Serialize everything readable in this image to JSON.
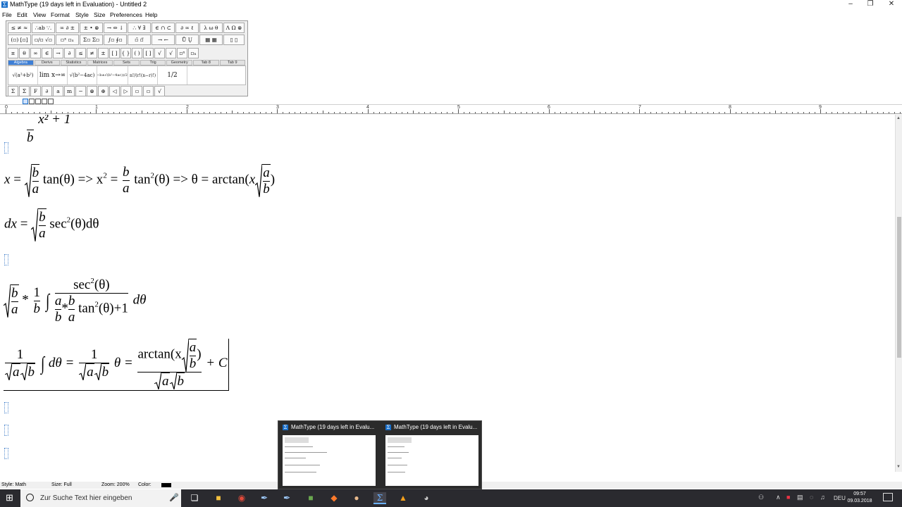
{
  "window": {
    "title": "MathType (19 days left in Evaluation) - Untitled 2",
    "app_icon": "Σ"
  },
  "menu": [
    "File",
    "Edit",
    "View",
    "Format",
    "Style",
    "Size",
    "Preferences",
    "Help"
  ],
  "toolbar": {
    "row1": [
      "≤ ≠ ≈",
      "∴ab ∵.",
      "∞ ∂ ±",
      "± • ⊗",
      "→ ⇔ ↓",
      "∴ ∀ ∃",
      "∈ ∩ ⊂",
      "∂ ∞ ℓ",
      "λ ω θ",
      "Λ Ω ⊗"
    ],
    "row2": [
      "(▫) [▫]",
      "▫/▫ √▫",
      "▫ˣ ▫ₓ",
      "Σ▫ Σ▫",
      "∫▫ ∮▫",
      "▫̄ ▫⃗",
      "→ ←",
      "Ů Ų",
      "▦ ▦",
      "▯ ▯"
    ],
    "row3": [
      "π",
      "θ",
      "∞",
      "∈",
      "→",
      "∂",
      "≤",
      "≠",
      "±",
      "[ ]",
      "{ }",
      "( )",
      "[ ]",
      "√",
      "√",
      "▫ⁿ",
      "▫ₙ"
    ],
    "tabs": [
      "Algebra",
      "Derivs",
      "Statistics",
      "Matrices",
      "Sets",
      "Trig",
      "Geometry",
      "Tab 8",
      "Tab 9"
    ],
    "active_tab": "Algebra",
    "bigrow": [
      "√(a²+b²)",
      "lim x→∞",
      "√(b²−4ac)",
      "(−b±√(b²−4ac))/2a",
      "n!/(r!(n−r)!)",
      "1/2"
    ],
    "row4": [
      "Σ",
      "Σ̄",
      "F",
      "∂",
      "a",
      "m",
      "−",
      "⊗",
      "⊕",
      "◁",
      "▷",
      "▫",
      "▫",
      "√"
    ]
  },
  "ruler": {
    "labels": [
      "0",
      "1",
      "2",
      "3",
      "4",
      "5",
      "6",
      "7",
      "8",
      "9"
    ]
  },
  "equations": {
    "partial_top": {
      "num": "",
      "den": "b",
      "rest": "x² + 1"
    },
    "eq1": {
      "x": "x",
      "eq": "=",
      "tan": "tan(θ) => x",
      "sq": "2",
      "eq2": "=",
      "b": "b",
      "a": "a",
      "tan2": "tan",
      "theta_impl": "(θ) => θ = arctan(",
      "xin": "x",
      "close": ")"
    },
    "eq2": {
      "dx": "dx",
      "eq": "=",
      "sec": "sec",
      "sq": "2",
      "rest": "(θ)dθ"
    },
    "eq3": {
      "times": "*",
      "one": "1",
      "secnum": "sec",
      "thetanum": "(θ)",
      "tan": "tan",
      "tanrest": "(θ)+1",
      "dtheta": "dθ"
    },
    "eq4": {
      "one": "1",
      "dtheta": "dθ =",
      "theta": "θ =",
      "arctan": "arctan(x",
      "close": ")",
      "plusc": "+ C"
    }
  },
  "status": {
    "style": "Style: Math",
    "size": "Size: Full",
    "zoom": "Zoom: 200%",
    "color": "Color:",
    "color_value": "#000000"
  },
  "taskbar": {
    "search_placeholder": "Zur Suche Text hier eingeben",
    "lang": "DEU",
    "time": "09:57",
    "date": "09.03.2018"
  },
  "preview": [
    {
      "title": "MathType (19 days left in Evalu..."
    },
    {
      "title": "MathType (19 days left in Evalu..."
    }
  ]
}
